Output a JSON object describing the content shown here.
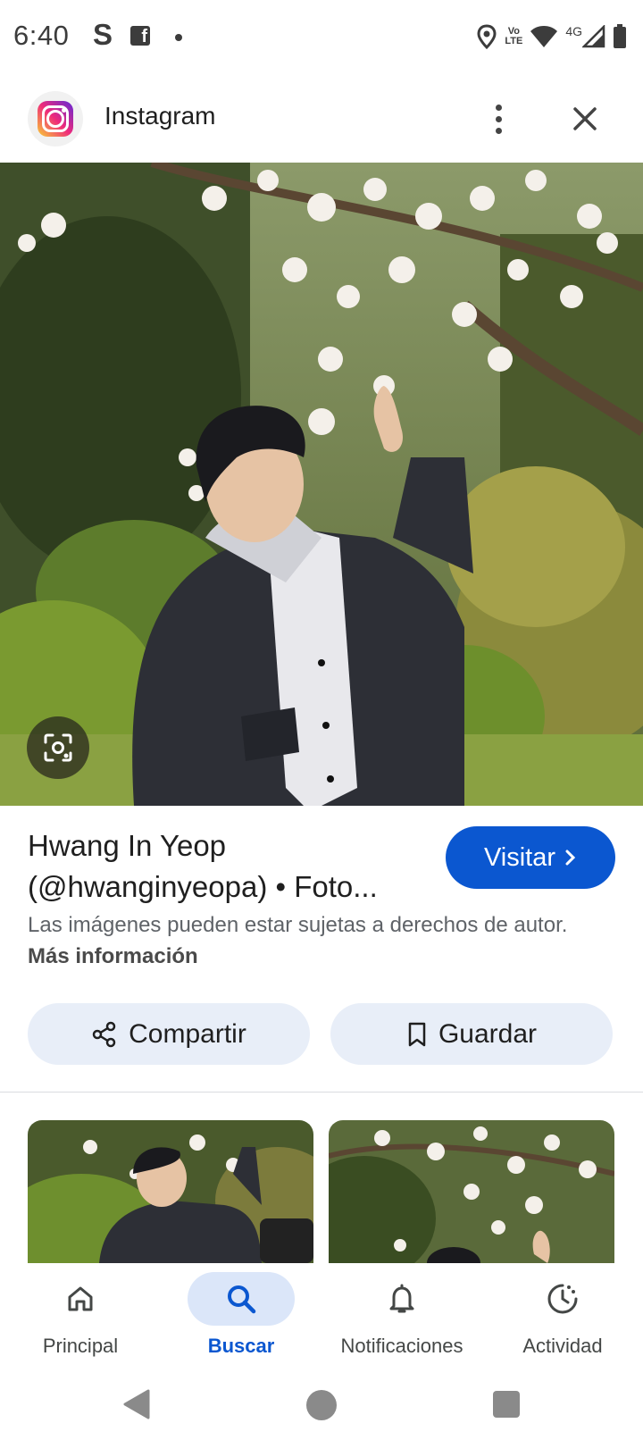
{
  "status_bar": {
    "time": "6:40",
    "app_icon_s": "S",
    "app_icon_f": "f",
    "volte_top": "Vo",
    "volte_bottom": "LTE",
    "network": "4G",
    "icons": [
      "location-icon",
      "wifi-icon",
      "signal-icon",
      "battery-icon"
    ]
  },
  "header": {
    "title": "Instagram",
    "logo_icon": "instagram-logo-icon",
    "menu_icon": "more-vertical-icon",
    "close_icon": "close-icon"
  },
  "result": {
    "title_line1": "Hwang In Yeop",
    "title_line2": "(@hwanginyeopa) • Foto...",
    "visit_label": "Visitar",
    "copyright_text": "Las imágenes pueden estar sujetas a derechos de autor.",
    "more_info": "Más información",
    "share_label": "Compartir",
    "save_label": "Guardar"
  },
  "bottom_nav": {
    "items": [
      {
        "label": "Principal",
        "icon": "home-icon",
        "active": false
      },
      {
        "label": "Buscar",
        "icon": "search-icon",
        "active": true
      },
      {
        "label": "Notificaciones",
        "icon": "bell-icon",
        "active": false
      },
      {
        "label": "Actividad",
        "icon": "activity-icon",
        "active": false
      }
    ]
  },
  "colors": {
    "accent": "#0b57d0",
    "chip_bg": "#e8eef8",
    "nav_active_bg": "#dbe6f9"
  }
}
